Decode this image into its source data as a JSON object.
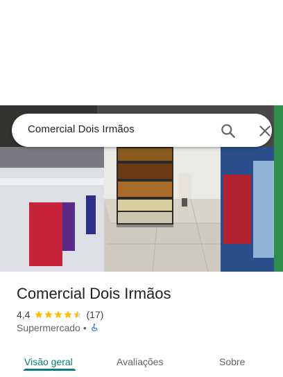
{
  "search": {
    "query": "Comercial Dois Irmãos"
  },
  "icons": {
    "search": "search-icon",
    "close": "close-icon",
    "accessibility": "wheelchair-icon",
    "star": "star-icon"
  },
  "place": {
    "name": "Comercial Dois Irmãos",
    "rating": "4,4",
    "rating_value": 4.4,
    "reviews": "(17)",
    "category": "Supermercado",
    "separator": "•"
  },
  "tabs": [
    {
      "label": "Visão geral",
      "active": true
    },
    {
      "label": "Avaliações",
      "active": false
    },
    {
      "label": "Sobre",
      "active": false
    }
  ],
  "colors": {
    "accent": "#0b7b80",
    "star": "#fbbc04",
    "accessibility": "#1a73e8"
  }
}
